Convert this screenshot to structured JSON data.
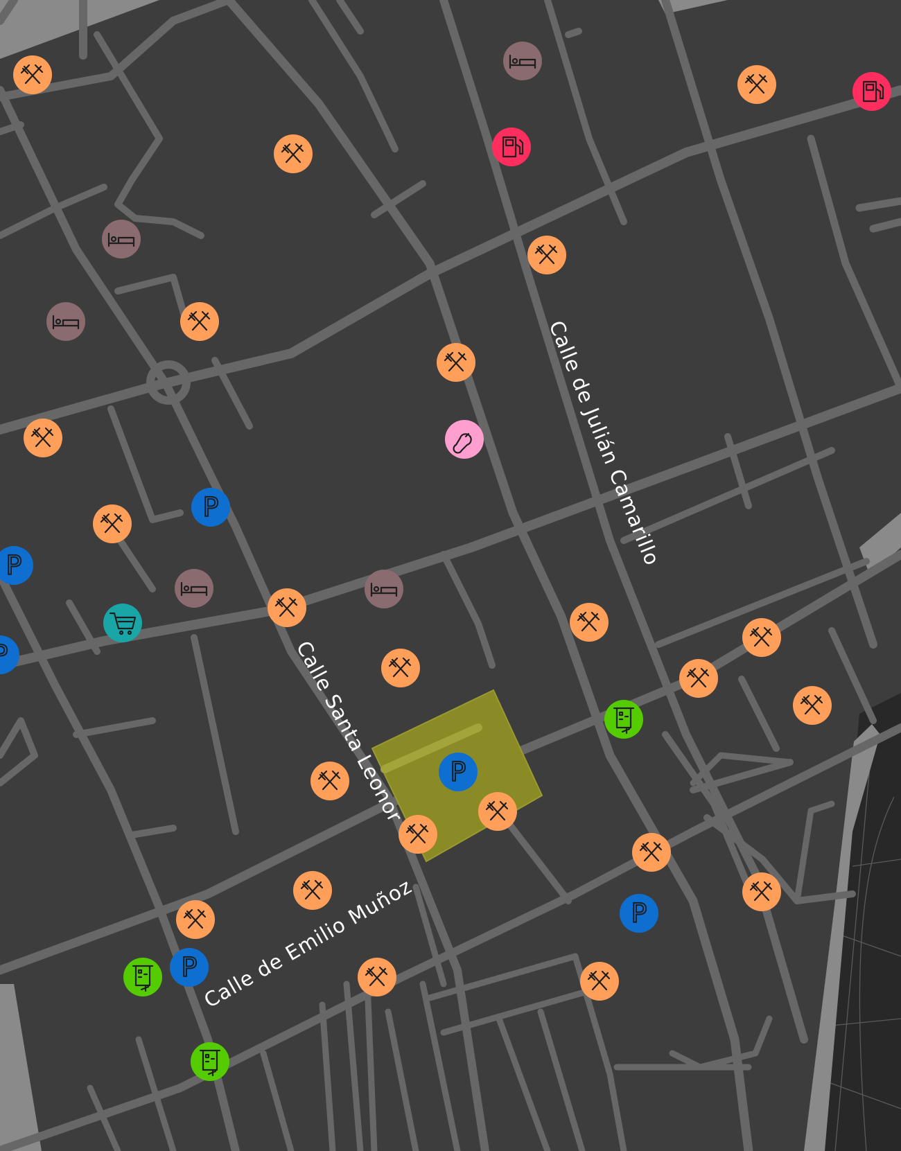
{
  "map": {
    "streets": [
      {
        "name": "Calle de Julián Camarillo"
      },
      {
        "name": "Calle Santa Leonor"
      },
      {
        "name": "Calle de Emilio Muñoz"
      }
    ],
    "poi_legend": {
      "restaurant": {
        "icon": "fork-knife-icon",
        "color": "#ff9f5a"
      },
      "hotel": {
        "icon": "bed-icon",
        "color": "#8a6b6f"
      },
      "fuel": {
        "icon": "fuel-pump-icon",
        "color": "#ff2e5e"
      },
      "parking": {
        "icon": "parking-icon",
        "color": "#0f6fd1"
      },
      "atm": {
        "icon": "atm-card-icon",
        "color": "#55cc00"
      },
      "shop": {
        "icon": "shopping-cart-icon",
        "color": "#1aa6a6"
      },
      "childcare": {
        "icon": "pacifier-icon",
        "color": "#ff9fcf"
      }
    },
    "highlight_area_color": "#8a8a26"
  }
}
